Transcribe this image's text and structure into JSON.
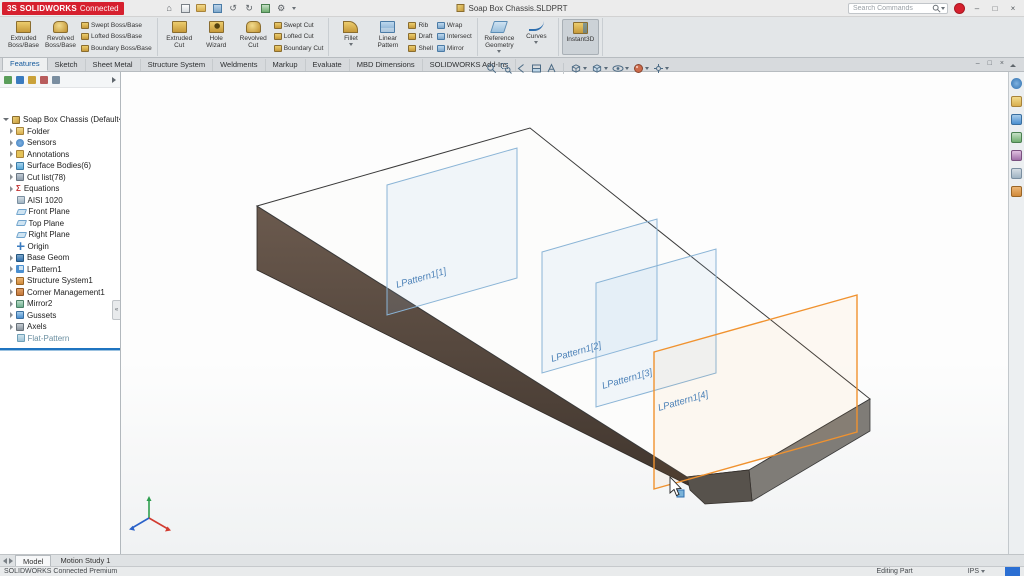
{
  "title_bar": {
    "logo_mark": "3S",
    "logo_primary": "SOLIDWORKS",
    "logo_secondary": "Connected",
    "document_title": "Soap Box Chassis.SLDPRT",
    "search_placeholder": "Search Commands"
  },
  "icons": {
    "minimize": "–",
    "maximize": "□",
    "close": "×",
    "home": "⌂",
    "undo": "↺",
    "redo": "↻",
    "settings": "⚙",
    "sigma": "Σ",
    "collapse_left": "«"
  },
  "ribbon": {
    "groups": [
      {
        "large": [
          {
            "line1": "Extruded",
            "line2": "Boss/Base"
          },
          {
            "line1": "Revolved",
            "line2": "Boss/Base"
          }
        ],
        "small": [
          "Swept Boss/Base",
          "Lofted Boss/Base",
          "Boundary Boss/Base"
        ]
      },
      {
        "large": [
          {
            "line1": "Extruded",
            "line2": "Cut"
          },
          {
            "line1": "Hole",
            "line2": "Wizard"
          },
          {
            "line1": "Revolved",
            "line2": "Cut"
          }
        ],
        "small": [
          "Swept Cut",
          "Lofted Cut",
          "Boundary Cut"
        ]
      },
      {
        "large": [
          {
            "line1": "Fillet",
            "line2": ""
          },
          {
            "line1": "Linear",
            "line2": "Pattern"
          }
        ],
        "small": [
          "Rib",
          "Draft",
          "Shell"
        ],
        "small2": [
          "Wrap",
          "Intersect",
          "Mirror"
        ]
      },
      {
        "large": [
          {
            "line1": "Reference",
            "line2": "Geometry"
          },
          {
            "line1": "Curves",
            "line2": ""
          }
        ]
      },
      {
        "large": [
          {
            "line1": "Instant3D",
            "line2": ""
          }
        ]
      }
    ]
  },
  "tabs": {
    "items": [
      "Features",
      "Sketch",
      "Sheet Metal",
      "Structure System",
      "Weldments",
      "Markup",
      "Evaluate",
      "MBD Dimensions",
      "SOLIDWORKS Add-Ins"
    ],
    "active": "Features"
  },
  "feature_tree": {
    "root": "Soap Box Chassis (Default<As Machin",
    "items": [
      {
        "label": "Folder"
      },
      {
        "label": "Sensors"
      },
      {
        "label": "Annotations"
      },
      {
        "label": "Surface Bodies(6)"
      },
      {
        "label": "Cut list(78)"
      },
      {
        "label": "Equations"
      },
      {
        "label": "AISI 1020"
      },
      {
        "label": "Front Plane"
      },
      {
        "label": "Top Plane"
      },
      {
        "label": "Right Plane"
      },
      {
        "label": "Origin"
      },
      {
        "label": "Base Geom"
      },
      {
        "label": "LPattern1"
      },
      {
        "label": "Structure System1"
      },
      {
        "label": "Corner Management1"
      },
      {
        "label": "Mirror2"
      },
      {
        "label": "Gussets"
      },
      {
        "label": "Axels"
      },
      {
        "label": "Flat-Pattern"
      }
    ]
  },
  "viewport": {
    "pattern_labels": [
      "LPattern1[1]",
      "LPattern1[2]",
      "LPattern1[3]",
      "LPattern1[4]"
    ]
  },
  "bottom": {
    "model_tab": "Model",
    "motion_tab": "Motion Study 1",
    "status_left": "SOLIDWORKS Connected Premium",
    "status_editing": "Editing Part",
    "units": "IPS"
  },
  "colors": {
    "accent_orange": "#f0922f",
    "plane_blue": "#8ab4d6",
    "logo_red": "#d6202e",
    "model_brown": "#5c4f45"
  }
}
